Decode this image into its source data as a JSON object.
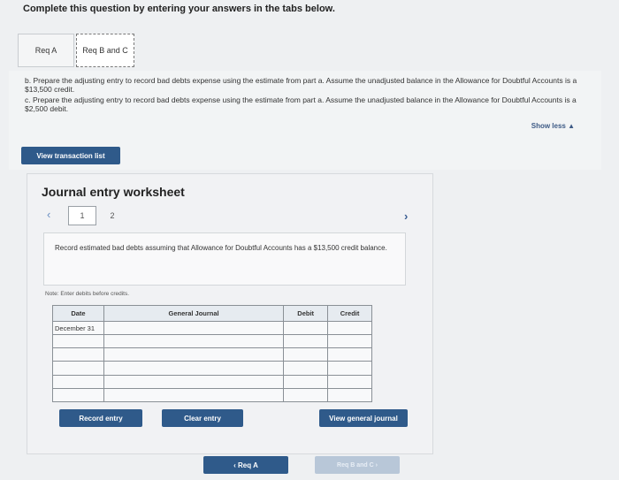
{
  "header": {
    "instruction": "Complete this question by entering your answers in the tabs below."
  },
  "tabs": [
    {
      "label": "Req A"
    },
    {
      "label": "Req B and C"
    }
  ],
  "requirements": {
    "b": "b. Prepare the adjusting entry to record bad debts expense using the estimate from part a. Assume the unadjusted balance in the Allowance for Doubtful Accounts is a $13,500 credit.",
    "c": "c. Prepare the adjusting entry to record bad debts expense using the estimate from part a. Assume the unadjusted balance in the Allowance for Doubtful Accounts is a $2,500 debit.",
    "show_less": "Show less ▲"
  },
  "buttons": {
    "view_transaction_list": "View transaction list",
    "record_entry": "Record entry",
    "clear_entry": "Clear entry",
    "view_general_journal": "View general journal"
  },
  "worksheet": {
    "title": "Journal entry worksheet",
    "pager_prev": "‹",
    "pager_next": "›",
    "pages": [
      "1",
      "2"
    ],
    "prompt": "Record estimated bad debts assuming that Allowance for Doubtful Accounts has a $13,500 credit balance.",
    "note": "Note: Enter debits before credits.",
    "columns": [
      "Date",
      "General Journal",
      "Debit",
      "Credit"
    ],
    "rows": [
      [
        "December 31",
        "",
        "",
        ""
      ],
      [
        "",
        "",
        "",
        ""
      ],
      [
        "",
        "",
        "",
        ""
      ],
      [
        "",
        "",
        "",
        ""
      ],
      [
        "",
        "",
        "",
        ""
      ],
      [
        "",
        "",
        "",
        ""
      ]
    ]
  },
  "bottom_nav": {
    "prev": "‹  Req A",
    "next": "Req B and C  ›"
  }
}
